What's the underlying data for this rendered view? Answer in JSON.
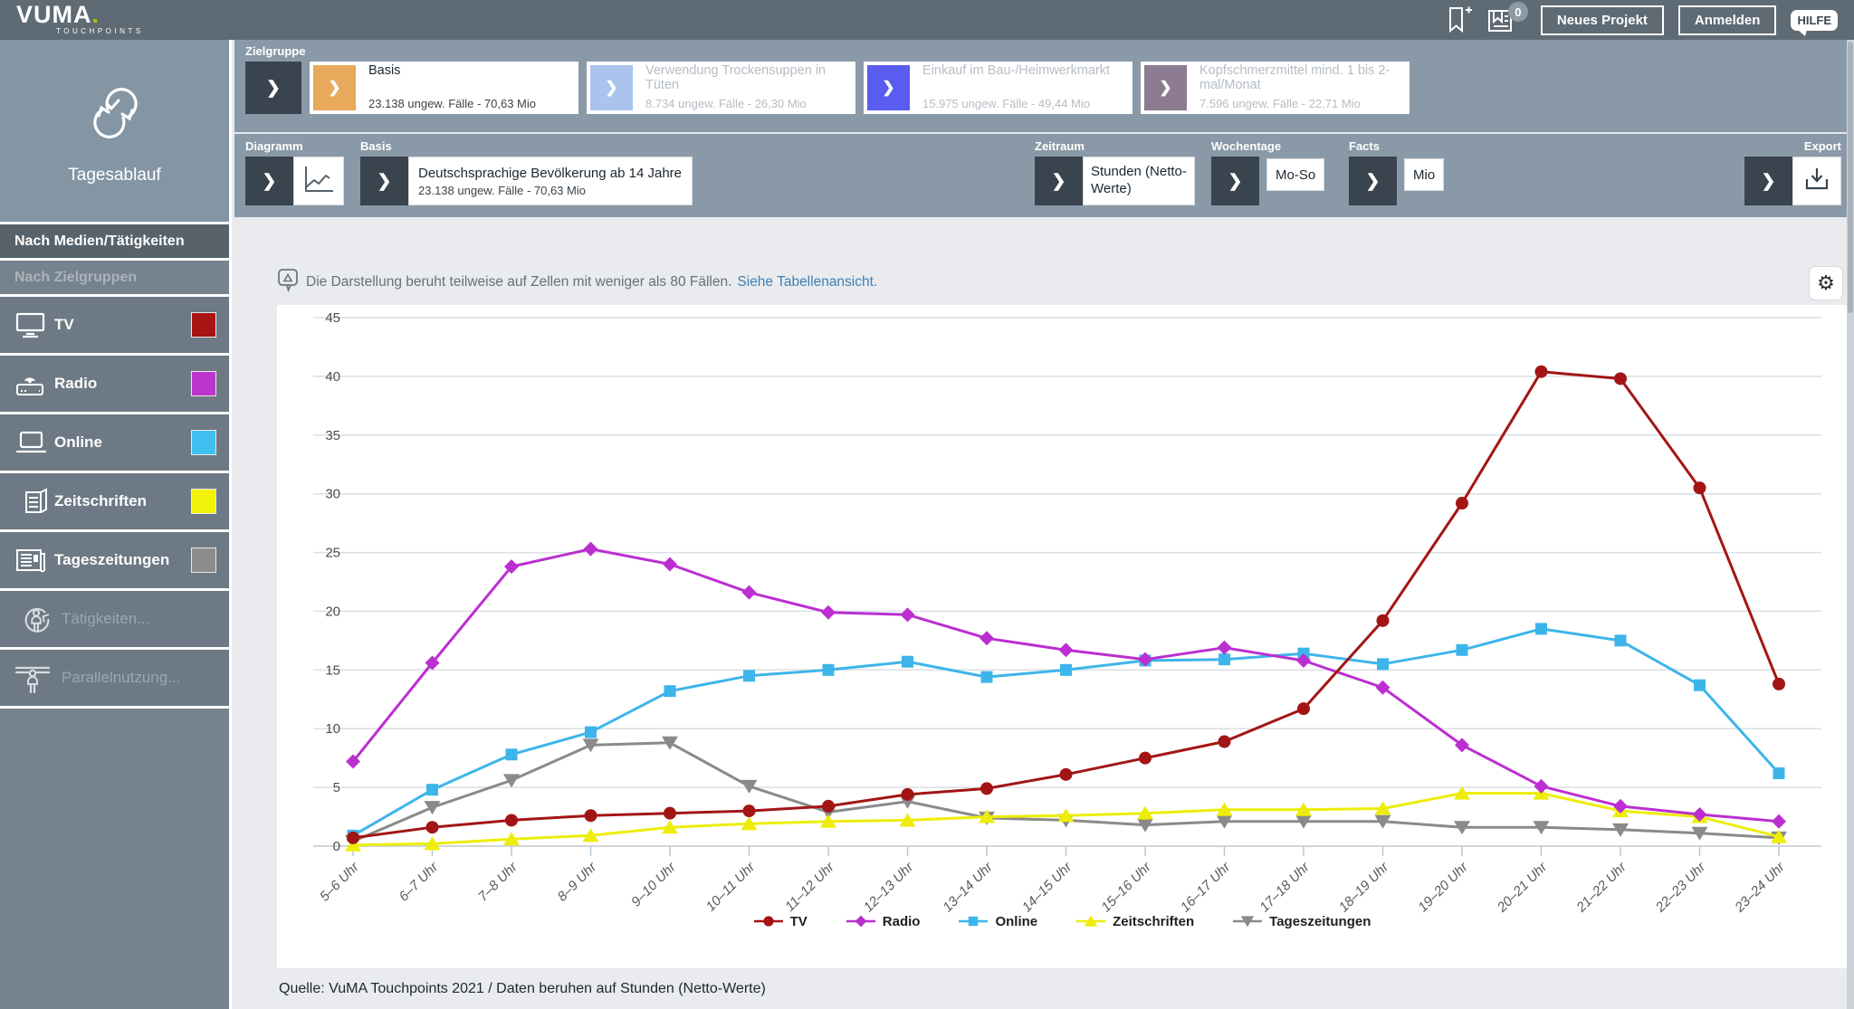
{
  "header": {
    "logo": "VUMA",
    "logo_dot": ".",
    "logo_sub": "TOUCHPOINTS",
    "badge_count": "0",
    "neues_projekt_label": "Neues Projekt",
    "anmelden_label": "Anmelden",
    "hilfe_label": "HILFE"
  },
  "sidebar": {
    "module_label": "Tagesablauf",
    "nav": [
      {
        "label": "Nach Medien/Tätigkeiten",
        "active": true
      },
      {
        "label": "Nach Zielgruppen",
        "active": false
      }
    ],
    "media_items": [
      {
        "label": "TV",
        "color": "#a81414"
      },
      {
        "label": "Radio",
        "color": "#bc35cc"
      },
      {
        "label": "Online",
        "color": "#3fc0f0"
      },
      {
        "label": "Zeitschriften",
        "color": "#f2f20a"
      },
      {
        "label": "Tageszeitungen",
        "color": "#8c8c8c"
      },
      {
        "label": "Tätigkeiten...",
        "disabled": true
      },
      {
        "label": "Parallelnutzung...",
        "disabled": true
      }
    ]
  },
  "zielgruppe": {
    "label": "Zielgruppe",
    "chips": [
      {
        "title": "Basis",
        "subtitle": "23.138 ungew. Fälle - 70,63 Mio",
        "accent": "#e9a95c",
        "active": true
      },
      {
        "title": "Verwendung Trockensuppen in Tüten",
        "subtitle": "8.734 ungew. Fälle - 26,30 Mio",
        "accent": "#aac4ee",
        "active": false
      },
      {
        "title": "Einkauf im Bau-/Heimwerkmarkt",
        "subtitle": "15.975 ungew. Fälle - 49,44 Mio",
        "accent": "#5a5cf0",
        "active": false
      },
      {
        "title": "Kopfschmerzmittel mind. 1 bis 2-mal/Monat",
        "subtitle": "7.596 ungew. Fälle - 22,71 Mio",
        "accent": "#8d7b91",
        "active": false
      }
    ]
  },
  "controls": {
    "diagramm_label": "Diagramm",
    "basis_label": "Basis",
    "basis_title": "Deutschsprachige Bevölkerung ab 14 Jahre",
    "basis_subtitle": "23.138 ungew. Fälle - 70,63 Mio",
    "zeitraum_label": "Zeitraum",
    "zeitraum_value": "Stunden (Netto-Werte)",
    "wochentage_label": "Wochentage",
    "wochentage_value": "Mo-So",
    "facts_label": "Facts",
    "facts_value": "Mio",
    "export_label": "Export"
  },
  "notice": {
    "text": "Die Darstellung beruht teilweise auf Zellen mit weniger als 80 Fällen.",
    "link": "Siehe Tabellenansicht."
  },
  "source_line": "Quelle: VuMA Touchpoints 2021 / Daten beruhen auf Stunden (Netto-Werte)",
  "chart_data": {
    "type": "line",
    "title": "",
    "xlabel": "",
    "ylabel": "",
    "ylim": [
      0,
      45
    ],
    "ytick_step": 5,
    "grid": true,
    "legend_position": "bottom",
    "categories": [
      "5–6 Uhr",
      "6–7 Uhr",
      "7–8 Uhr",
      "8–9 Uhr",
      "9–10 Uhr",
      "10–11 Uhr",
      "11–12 Uhr",
      "12–13 Uhr",
      "13–14 Uhr",
      "14–15 Uhr",
      "15–16 Uhr",
      "16–17 Uhr",
      "17–18 Uhr",
      "18–19 Uhr",
      "19–20 Uhr",
      "20–21 Uhr",
      "21–22 Uhr",
      "22–23 Uhr",
      "23–24 Uhr"
    ],
    "series": [
      {
        "name": "TV",
        "color": "#a31515",
        "marker": "circle",
        "values": [
          0.7,
          1.6,
          2.2,
          2.6,
          2.8,
          3.0,
          3.4,
          4.4,
          4.9,
          6.1,
          7.5,
          8.9,
          11.7,
          19.2,
          29.2,
          40.4,
          39.8,
          30.5,
          13.8
        ]
      },
      {
        "name": "Radio",
        "color": "#bb2fd0",
        "marker": "diamond",
        "values": [
          7.2,
          15.6,
          23.8,
          25.3,
          24.0,
          21.6,
          19.9,
          19.7,
          17.7,
          16.7,
          15.9,
          16.9,
          15.8,
          13.5,
          8.6,
          5.1,
          3.4,
          2.7,
          2.1
        ]
      },
      {
        "name": "Online",
        "color": "#3db5ea",
        "marker": "square",
        "values": [
          0.9,
          4.8,
          7.8,
          9.7,
          13.2,
          14.5,
          15.0,
          15.7,
          14.4,
          15.0,
          15.8,
          15.9,
          16.4,
          15.5,
          16.7,
          18.5,
          17.5,
          13.7,
          6.2
        ]
      },
      {
        "name": "Zeitschriften",
        "color": "#eded09",
        "marker": "triangle-up",
        "values": [
          0.1,
          0.2,
          0.6,
          0.9,
          1.6,
          1.9,
          2.1,
          2.2,
          2.5,
          2.6,
          2.8,
          3.1,
          3.1,
          3.2,
          4.5,
          4.5,
          3.0,
          2.5,
          0.8
        ]
      },
      {
        "name": "Tageszeitungen",
        "color": "#8a8a8a",
        "marker": "triangle-down",
        "values": [
          0.4,
          3.3,
          5.6,
          8.6,
          8.8,
          5.1,
          2.9,
          3.8,
          2.4,
          2.2,
          1.8,
          2.1,
          2.1,
          2.1,
          1.6,
          1.6,
          1.4,
          1.1,
          0.7
        ]
      }
    ]
  }
}
